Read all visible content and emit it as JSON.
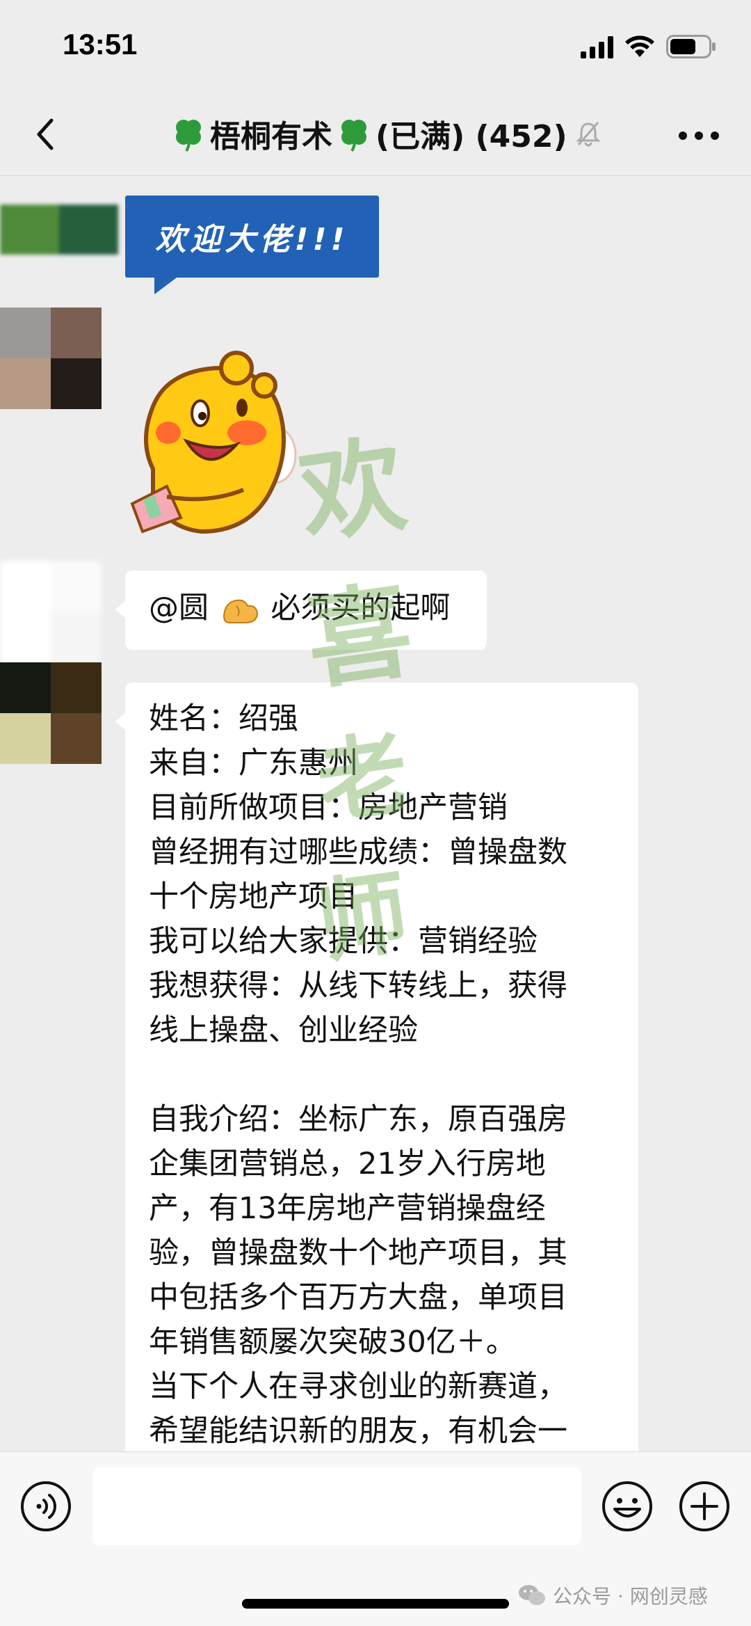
{
  "status_bar": {
    "time": "13:51"
  },
  "nav": {
    "title_name": "梧桐有术",
    "title_suffix": "(已满) (452)",
    "icons": [
      "back-chevron-icon",
      "clover-icon",
      "mute-bell-icon",
      "more-dots-icon"
    ]
  },
  "messages": {
    "welcome_banner": "欢迎大佬!!!",
    "mention_prefix": "@圆",
    "mention_rest": "必须买的起啊",
    "intro_lines": [
      "姓名：绍强",
      "来自：广东惠州",
      "目前所做项目：房地产营销",
      "曾经拥有过哪些成绩：曾操盘数",
      "十个房地产项目",
      "我可以给大家提供：营销经验",
      "我想获得：从线下转线上，获得",
      "线上操盘、创业经验",
      "",
      "自我介绍：坐标广东，原百强房",
      "企集团营销总，21岁入行房地",
      "产，有13年房地产营销操盘经",
      "验，曾操盘数十个地产项目，其",
      "中包括多个百万方大盘，单项目",
      "年销售额屡次突破30亿＋。",
      "当下个人在寻求创业的新赛道，",
      "希望能结识新的朋友，有机会一"
    ]
  },
  "sticker": {
    "name": "qq-penguin-sticker"
  },
  "watermark": {
    "chars": [
      "欢",
      "喜",
      "老",
      "师"
    ]
  },
  "input_bar": {
    "placeholder": ""
  },
  "footer": {
    "label": "公众号 · 网创灵感"
  },
  "colors": {
    "background": "#ededed",
    "banner_blue": "#2262b6",
    "bubble": "#ffffff"
  }
}
